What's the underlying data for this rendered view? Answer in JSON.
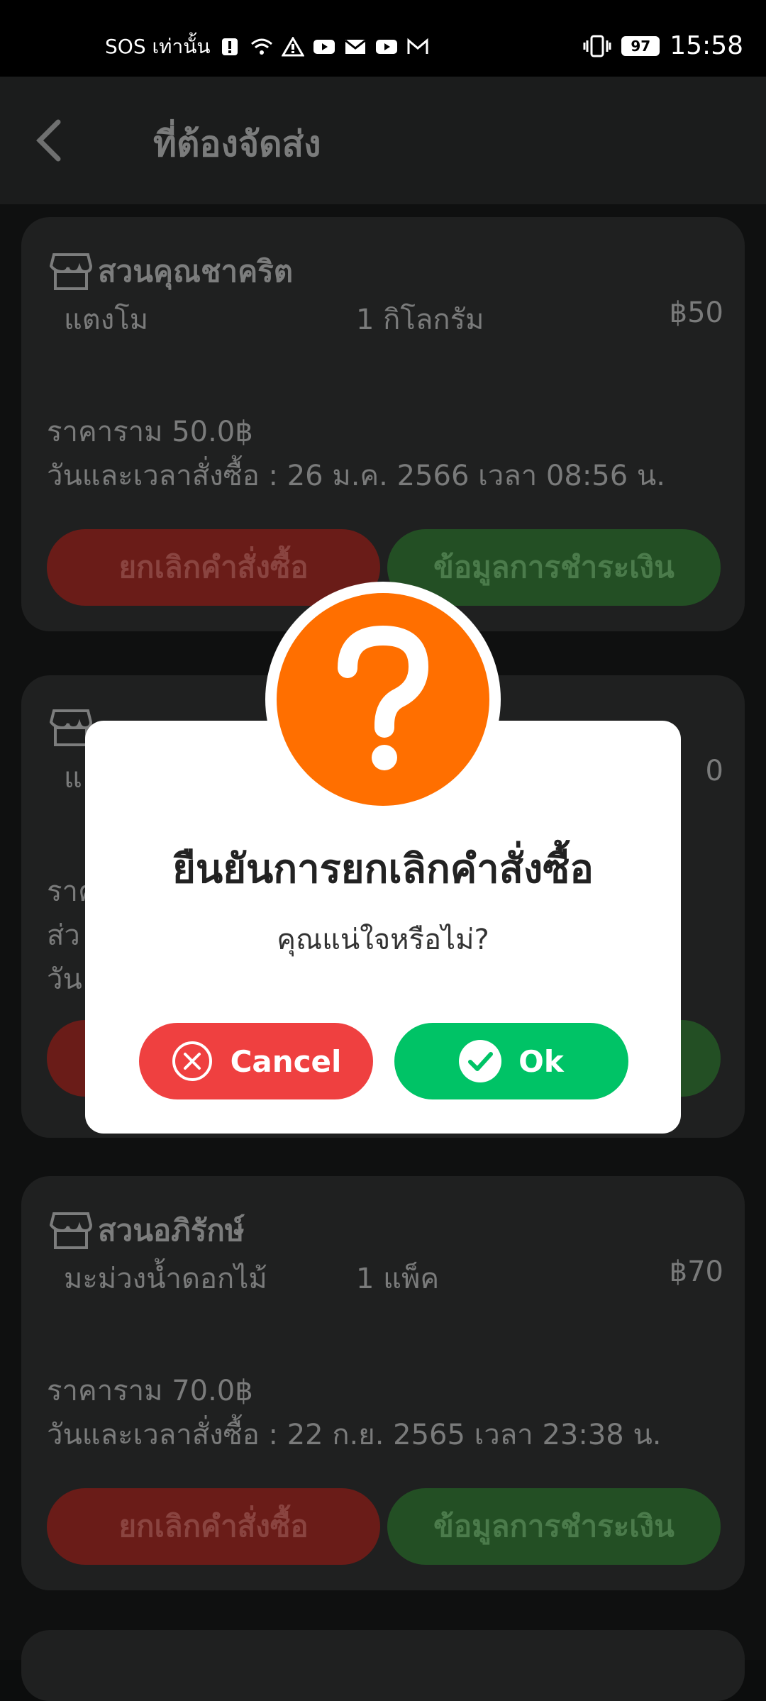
{
  "status_bar": {
    "carrier": "SOS เท่านั้น",
    "battery": "97",
    "time": "15:58"
  },
  "header": {
    "title": "ที่ต้องจัดส่ง"
  },
  "orders": [
    {
      "shop": "สวนคุณชาคริต",
      "item": "แตงโม",
      "qty": "1 กิโลกรัม",
      "price": "฿50",
      "total": "ราคาราม 50.0฿",
      "datetime": "วันและเวลาสั่งซื้อ : 26 ม.ค. 2566 เวลา 08:56 น.",
      "cancel_label": "ยกเลิกคำสั่งซื้อ",
      "payment_label": "ข้อมูลการชำระเงิน"
    },
    {
      "shop": "สวนอภิรักษ์",
      "item": "มะม่วงน้ำดอกไม้",
      "qty": "1 แพ็ค",
      "price": "฿70",
      "total": "ราคาราม 70.0฿",
      "datetime": "วันและเวลาสั่งซื้อ : 22 ก.ย. 2565 เวลา 23:38 น.",
      "cancel_label": "ยกเลิกคำสั่งซื้อ",
      "payment_label": "ข้อมูลการชำระเงิน"
    }
  ],
  "hidden_card_fragments": {
    "item_prefix": "แ",
    "price_suffix": "0",
    "line1_prefix": "ราค",
    "line2_prefix": "ส่ว",
    "line3_prefix": "วัน"
  },
  "dialog": {
    "title": "ยืนยันการยกเลิกคำสั่งซื้อ",
    "message": "คุณแน่ใจหรือไม่?",
    "cancel_label": "Cancel",
    "ok_label": "Ok"
  },
  "colors": {
    "warning_orange": "#ff6f00",
    "cancel_red": "#ef4040",
    "ok_green": "#00c366"
  }
}
